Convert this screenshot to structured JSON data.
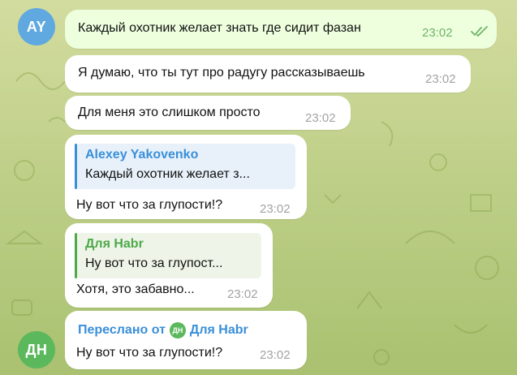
{
  "colors": {
    "avatar_ay": "#5fa8e0",
    "avatar_dn": "#5cb85c",
    "own_bubble": "#eeffde",
    "reply_blue": "#3a8fd9",
    "reply_green": "#4fa84a",
    "check_green": "#6fb36a"
  },
  "avatars": {
    "ay": "AY",
    "dn": "ДН"
  },
  "messages": [
    {
      "text": "Каждый охотник желает знать где сидит фазан",
      "time": "23:02",
      "status_icon": "double-check-icon"
    },
    {
      "text": "Я думаю, что ты тут про радугу рассказываешь",
      "time": "23:02"
    },
    {
      "text": "Для меня это слишком просто",
      "time": "23:02"
    },
    {
      "reply_author": "Alexey Yakovenko",
      "reply_text": "Каждый охотник желает з...",
      "text": "Ну вот что за глупости!?",
      "time": "23:02"
    },
    {
      "reply_author": "Для Habr",
      "reply_text": "Ну вот что за глупост...",
      "text": "Хотя, это забавно...",
      "time": "23:02"
    },
    {
      "forward_prefix": "Переслано от",
      "forward_avatar": "ДН",
      "forward_author": "Для Habr",
      "text": "Ну вот что за глупости!?",
      "time": "23:02"
    }
  ]
}
